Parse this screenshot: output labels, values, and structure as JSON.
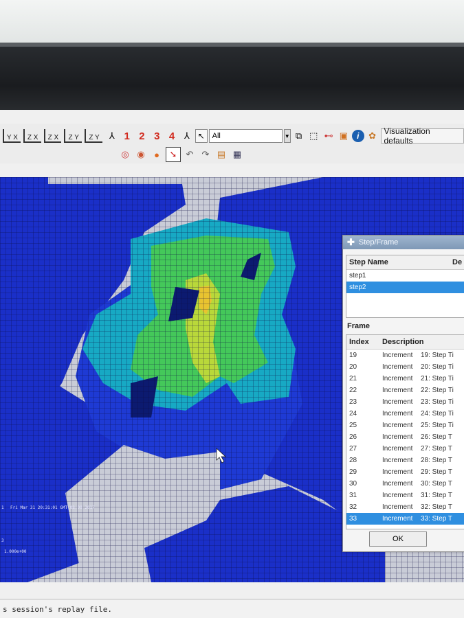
{
  "toolbar": {
    "axis_buttons": [
      "Y X",
      "Z X",
      "Z X",
      "Z Y",
      "Z Y"
    ],
    "numbers": [
      "1",
      "2",
      "3",
      "4"
    ],
    "select_value": "All",
    "visualization_label": "Visualization defaults"
  },
  "viewport": {
    "timestamp": "Fri Mar 31 20:31:01 GMT+08:00 2017",
    "left_label_1": "1",
    "left_label_2": "3",
    "left_label_3": "1.000e+00"
  },
  "command_line": {
    "text": "s session's replay file."
  },
  "dialog": {
    "title": "Step/Frame",
    "step_headers": {
      "name": "Step Name",
      "desc": "De"
    },
    "steps": [
      "step1",
      "step2"
    ],
    "selected_step": "step2",
    "frame_label": "Frame",
    "frame_headers": {
      "index": "Index",
      "description": "Description"
    },
    "frames": [
      {
        "index": "19",
        "type": "Increment",
        "desc": "19: Step Ti"
      },
      {
        "index": "20",
        "type": "Increment",
        "desc": "20: Step Ti"
      },
      {
        "index": "21",
        "type": "Increment",
        "desc": "21: Step Ti"
      },
      {
        "index": "22",
        "type": "Increment",
        "desc": "22: Step Ti"
      },
      {
        "index": "23",
        "type": "Increment",
        "desc": "23: Step Ti"
      },
      {
        "index": "24",
        "type": "Increment",
        "desc": "24: Step Ti"
      },
      {
        "index": "25",
        "type": "Increment",
        "desc": "25: Step Ti"
      },
      {
        "index": "26",
        "type": "Increment",
        "desc": "26: Step T"
      },
      {
        "index": "27",
        "type": "Increment",
        "desc": "27: Step T"
      },
      {
        "index": "28",
        "type": "Increment",
        "desc": "28: Step T"
      },
      {
        "index": "29",
        "type": "Increment",
        "desc": "29: Step T"
      },
      {
        "index": "30",
        "type": "Increment",
        "desc": "30: Step T"
      },
      {
        "index": "31",
        "type": "Increment",
        "desc": "31: Step T"
      },
      {
        "index": "32",
        "type": "Increment",
        "desc": "32: Step T"
      },
      {
        "index": "33",
        "type": "Increment",
        "desc": "33: Step T"
      }
    ],
    "selected_frame": "33",
    "ok_label": "OK"
  },
  "colors": {
    "mesh_blue": "#1a2fc8",
    "mesh_cyan": "#17b8c8",
    "mesh_green": "#3ccf3c",
    "mesh_yellow": "#d8d83a",
    "selection": "#2f8fe0"
  }
}
